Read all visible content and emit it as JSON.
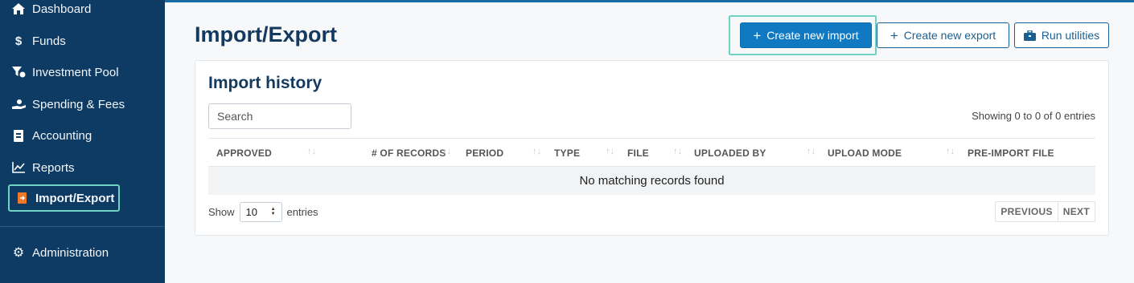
{
  "sidebar": {
    "items": [
      {
        "label": "Dashboard",
        "icon": "home-icon"
      },
      {
        "label": "Funds",
        "icon": "dollar-icon"
      },
      {
        "label": "Investment Pool",
        "icon": "pool-icon"
      },
      {
        "label": "Spending & Fees",
        "icon": "hand-coin-icon"
      },
      {
        "label": "Accounting",
        "icon": "ledger-icon"
      },
      {
        "label": "Reports",
        "icon": "line-chart-icon"
      },
      {
        "label": "Import/Export",
        "icon": "import-export-icon",
        "active": true
      },
      {
        "label": "Administration",
        "icon": "gear-icon"
      }
    ]
  },
  "header": {
    "title": "Import/Export",
    "buttons": {
      "create_import": "Create new import",
      "create_export": "Create new export",
      "run_utilities": "Run utilities"
    }
  },
  "import_history": {
    "title": "Import history",
    "search_placeholder": "Search",
    "info": "Showing 0 to 0 of 0 entries",
    "columns": [
      "APPROVED",
      "# OF RECORDS",
      "PERIOD",
      "TYPE",
      "FILE",
      "UPLOADED BY",
      "UPLOAD MODE",
      "PRE-IMPORT FILE"
    ],
    "empty_message": "No matching records found",
    "length": {
      "prefix": "Show",
      "value": "10",
      "suffix": "entries"
    },
    "pagination": {
      "previous": "PREVIOUS",
      "next": "NEXT"
    }
  },
  "colors": {
    "sidebar_bg": "#0e3b63",
    "primary": "#1179c2",
    "focus_ring": "#6fd3c4",
    "title": "#133a5e"
  }
}
